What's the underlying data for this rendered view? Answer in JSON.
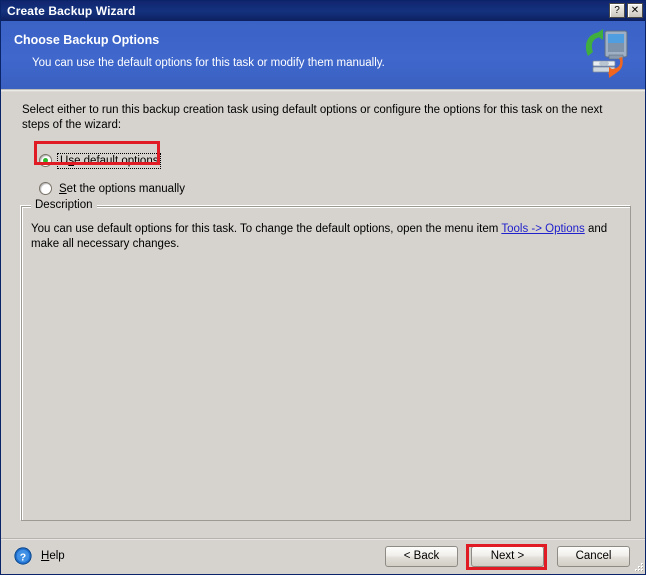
{
  "window": {
    "title": "Create Backup Wizard",
    "titlebar_buttons": [
      {
        "name": "help-titlebar-button",
        "glyph": "?"
      },
      {
        "name": "close-titlebar-button",
        "glyph": "✕"
      }
    ]
  },
  "banner": {
    "heading": "Choose Backup Options",
    "subheading": "You can use the default options for this task or modify them manually.",
    "icon": "backup-server-icon",
    "background_color": "#3d65c9"
  },
  "body": {
    "intro": "Select either to run this backup creation task using default options or configure the options for this task on the next steps of the wizard:",
    "options": [
      {
        "label_prefix": "U",
        "label_accel": "s",
        "label_suffix": "e default options",
        "label_full": "Use default options",
        "selected": true,
        "focused": true
      },
      {
        "label_prefix": "",
        "label_accel": "S",
        "label_suffix": "et the options manually",
        "label_full": "Set the options manually",
        "selected": false,
        "focused": false
      }
    ],
    "description": {
      "legend": "Description",
      "text_before": "You can use default options for this task. To change the default options, open the menu item ",
      "link_text": "Tools -> Options",
      "text_after": " and make all necessary changes."
    }
  },
  "footer": {
    "help_icon": "question-mark-icon",
    "help_label": "Help",
    "help_accel": "H",
    "buttons": [
      {
        "name": "back-button",
        "label": "< Back",
        "accel": "B"
      },
      {
        "name": "next-button",
        "label": "Next >",
        "accel": "N"
      },
      {
        "name": "cancel-button",
        "label": "Cancel",
        "accel": "C"
      }
    ]
  },
  "annotations": {
    "highlight_color": "#e01b24",
    "targets": [
      "Use default options",
      "Next >"
    ]
  }
}
